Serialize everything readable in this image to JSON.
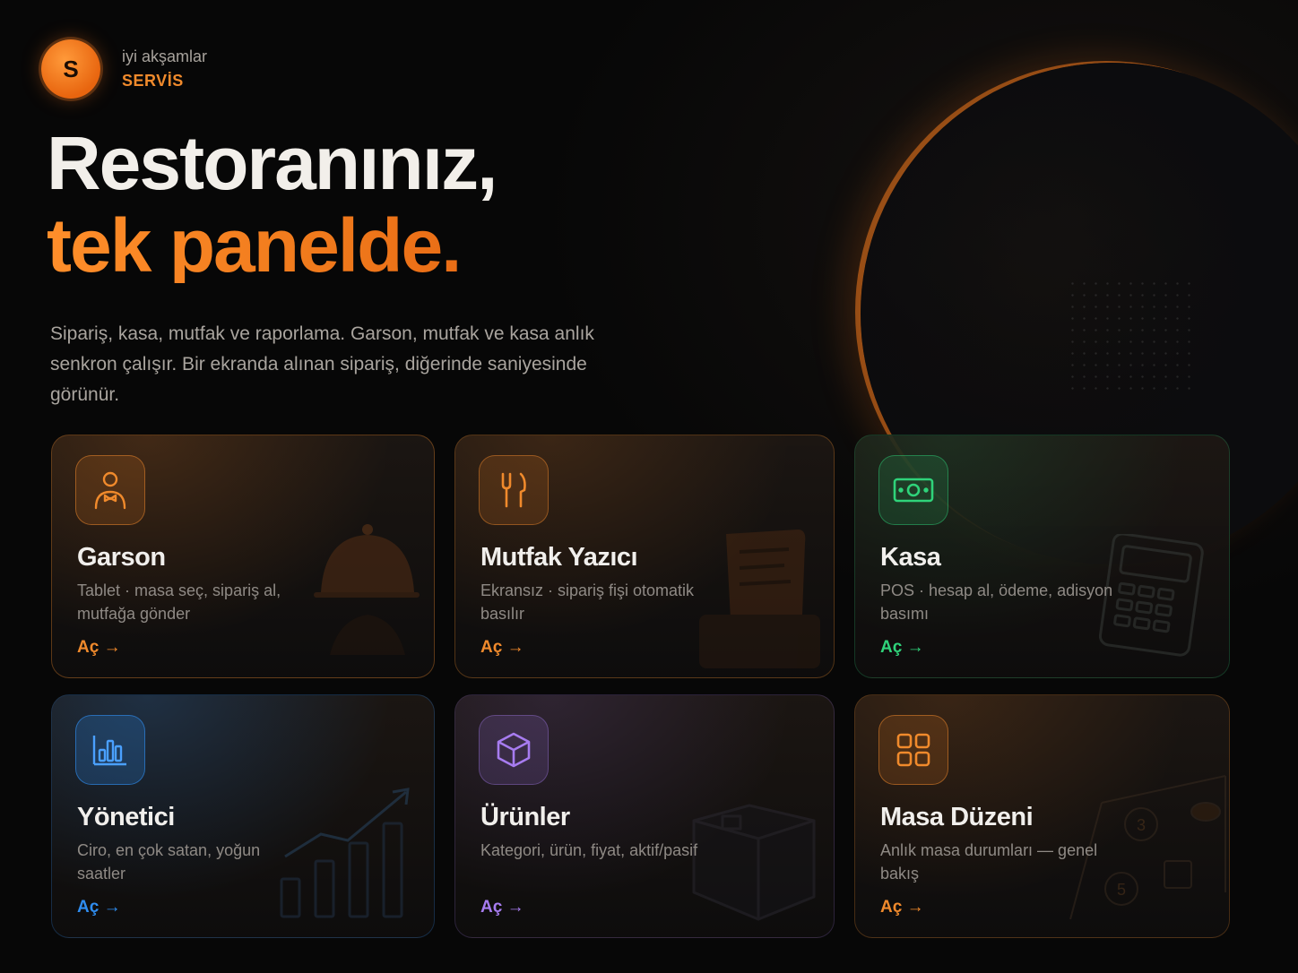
{
  "header": {
    "avatar_letter": "S",
    "greeting": "iyi akşamlar",
    "brand": "SERVİS"
  },
  "hero": {
    "line1": "Restoranınız,",
    "line2": "tek panelde.",
    "description": "Sipariş, kasa, mutfak ve raporlama. Garson, mutfak ve kasa anlık senkron çalışır. Bir ekranda alınan sipariş, diğerinde saniyesinde görünür."
  },
  "cards": [
    {
      "title": "Garson",
      "subtitle": "Tablet · masa seç, sipariş al, mutfağa gönder",
      "open": "Aç →",
      "icon": "waiter-icon",
      "accent": "#f08a2c"
    },
    {
      "title": "Mutfak Yazıcı",
      "subtitle": "Ekransız · sipariş fişi otomatik basılır",
      "open": "Aç →",
      "icon": "fork-knife-icon",
      "accent": "#f08a2c"
    },
    {
      "title": "Kasa",
      "subtitle": "POS · hesap al, ödeme, adisyon basımı",
      "open": "Aç →",
      "icon": "cash-icon",
      "accent": "#2fd37a"
    },
    {
      "title": "Yönetici",
      "subtitle": "Ciro, en çok satan, yoğun saatler",
      "open": "Aç →",
      "icon": "bar-chart-icon",
      "accent": "#2f8df0"
    },
    {
      "title": "Ürünler",
      "subtitle": "Kategori, ürün, fiyat, aktif/pasif",
      "open": "Aç →",
      "icon": "box-icon",
      "accent": "#a77cf0"
    },
    {
      "title": "Masa Düzeni",
      "subtitle": "Anlık masa durumları — genel bakış",
      "open": "Aç →",
      "icon": "grid-icon",
      "accent": "#f08a2c"
    }
  ],
  "deco_labels": {
    "table_a": "3",
    "table_b": "5"
  }
}
